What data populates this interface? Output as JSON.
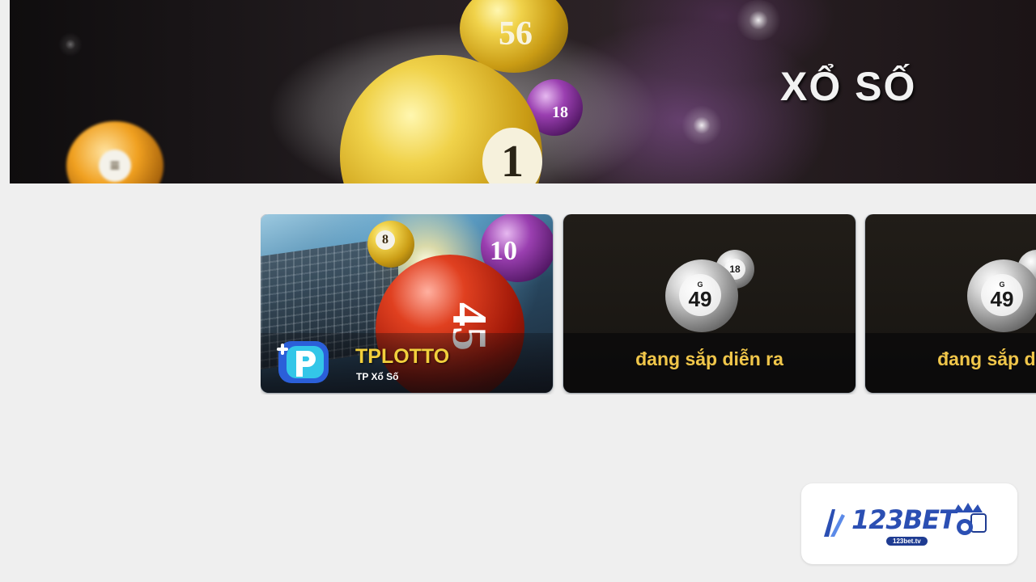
{
  "hero": {
    "title": "XỔ SỐ",
    "balls": [
      "56",
      "18",
      "1"
    ]
  },
  "cards": [
    {
      "name": "TPLOTTO",
      "subtitle": "TP Xổ Số",
      "balls": [
        "8",
        "10",
        "45"
      ]
    },
    {
      "status_text": "đang sắp diễn ra",
      "ball_letter": "G",
      "ball_number": "49",
      "back_ball_number": "18"
    },
    {
      "status_text": "đang sắp diễn ra",
      "ball_letter": "G",
      "ball_number": "49"
    }
  ],
  "watermark": {
    "brand": "123BET",
    "url": "123bet.tv"
  },
  "colors": {
    "page_bg": "#efefef",
    "accent_gold": "#f0c64a",
    "brand_blue": "#2b4fb3"
  }
}
